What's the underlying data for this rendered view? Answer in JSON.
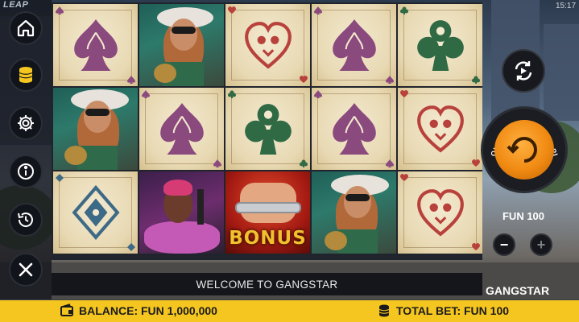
{
  "app": {
    "logo": "LEAP",
    "clock": "15:17",
    "game_name": "GANGSTAR"
  },
  "sidebar": {
    "buttons": [
      {
        "id": "home",
        "icon": "home-icon"
      },
      {
        "id": "coins",
        "icon": "coin-stack-icon"
      },
      {
        "id": "settings",
        "icon": "gear-icon"
      },
      {
        "id": "info",
        "icon": "info-icon"
      },
      {
        "id": "history",
        "icon": "history-icon"
      },
      {
        "id": "close",
        "icon": "close-icon"
      }
    ]
  },
  "reels": {
    "rows": [
      [
        "spade",
        "woman",
        "heart",
        "spade",
        "club"
      ],
      [
        "woman",
        "spade",
        "club",
        "spade",
        "heart"
      ],
      [
        "diamond",
        "gangster",
        "bonus",
        "woman",
        "heart"
      ]
    ],
    "bonus_label": "BONUS"
  },
  "controls": {
    "autoplay_icon": "autoplay-icon",
    "spin_hint": "HOLD FOR TURBO SPIN",
    "bet_value": "FUN 100",
    "minus_label": "−",
    "plus_label": "+"
  },
  "message": "WELCOME TO GANGSTAR",
  "footer": {
    "balance_label": "BALANCE: FUN 1,000,000",
    "total_bet_label": "TOTAL BET: FUN 100"
  },
  "colors": {
    "footer_bg": "#f5c61f",
    "spin_orange": "#f08a12",
    "spade": "#8a4a7d",
    "club": "#2f6a45",
    "heart": "#b8413c",
    "diamond": "#3d6a86"
  }
}
